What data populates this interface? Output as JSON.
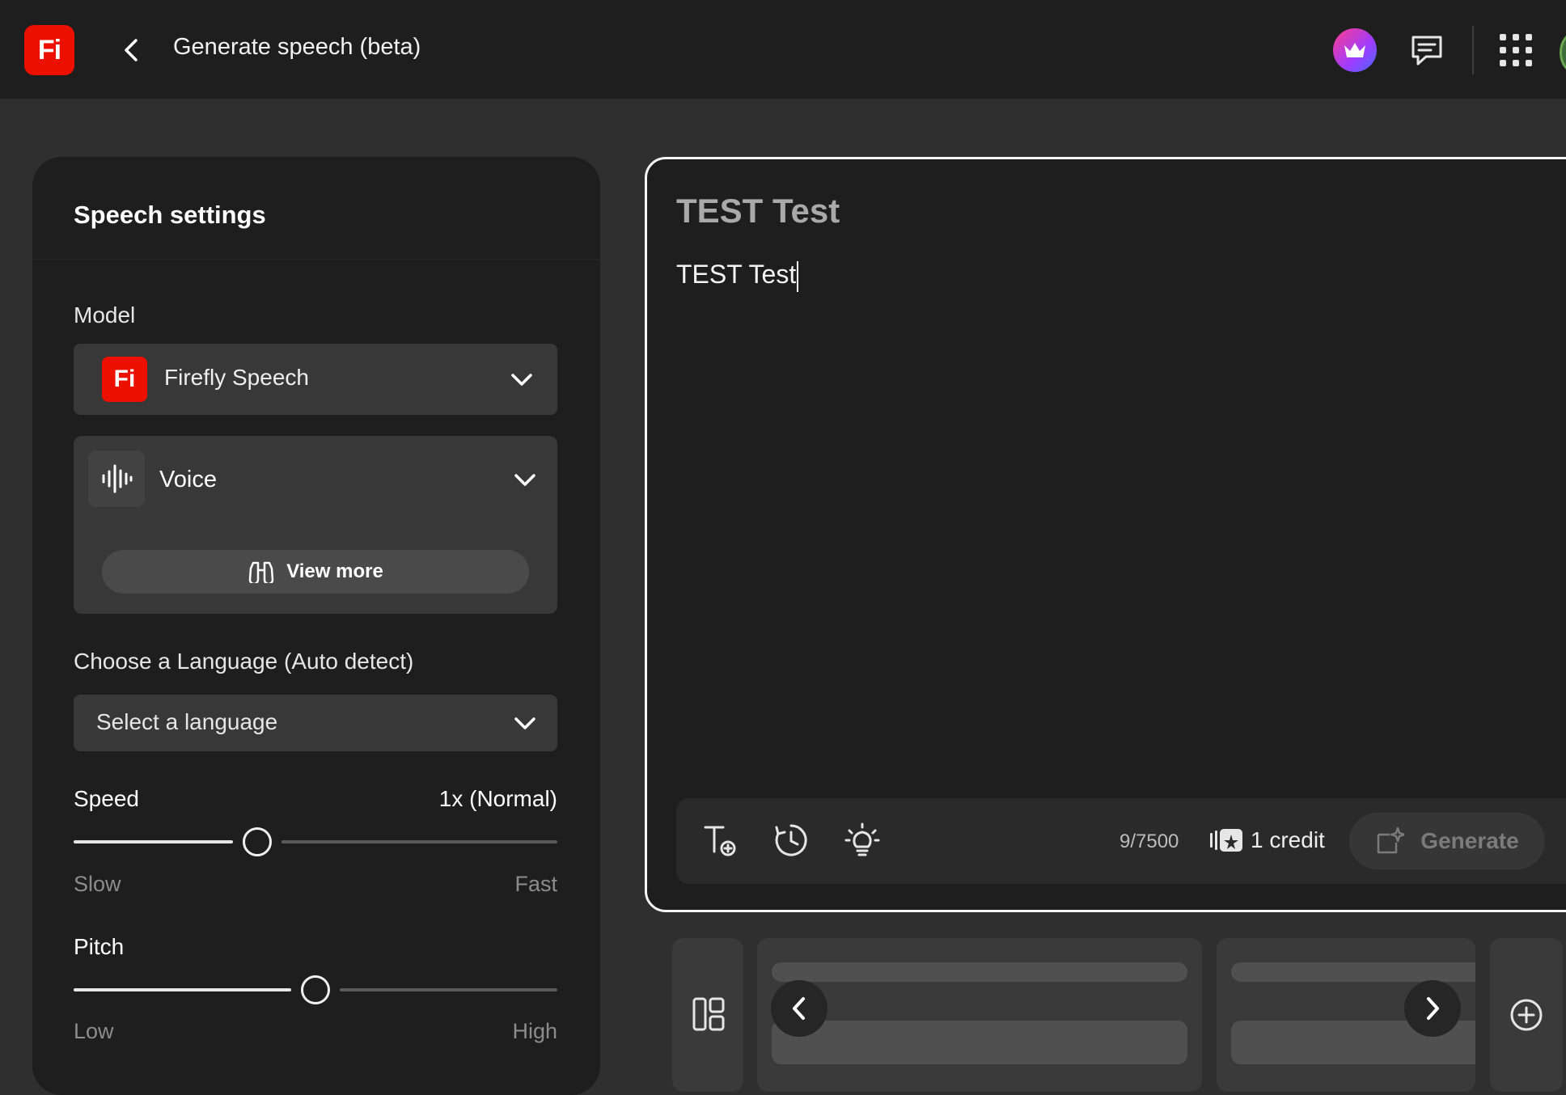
{
  "header": {
    "app_logo": "Fi",
    "title": "Generate speech (beta)"
  },
  "settings": {
    "title": "Speech settings",
    "model_label": "Model",
    "model_logo": "Fi",
    "model_value": "Firefly Speech",
    "voice_value": "Voice",
    "view_more_label": "View more",
    "language_label": "Choose a Language (Auto detect)",
    "language_placeholder": "Select a language",
    "speed": {
      "label": "Speed",
      "value_text": "1x (Normal)",
      "min_label": "Slow",
      "max_label": "Fast",
      "position": 0.38
    },
    "pitch": {
      "label": "Pitch",
      "min_label": "Low",
      "max_label": "High",
      "position": 0.5
    }
  },
  "editor": {
    "title": "TEST Test",
    "body": "TEST Test",
    "char_count": "9/7500",
    "credit_label": "1 credit",
    "generate_label": "Generate"
  },
  "colors": {
    "accent_red": "#eb1000",
    "panel_bg": "#1e1e1e",
    "page_bg": "#2f2f2f"
  },
  "icons": [
    "back-chevron-icon",
    "crown-icon",
    "chat-icon",
    "apps-grid-icon",
    "waveform-icon",
    "binoculars-icon",
    "text-add-icon",
    "history-icon",
    "lightbulb-icon",
    "credit-icon",
    "sparkle-generate-icon",
    "layout-icon",
    "chevron-left-icon",
    "chevron-right-icon",
    "add-circle-icon"
  ]
}
